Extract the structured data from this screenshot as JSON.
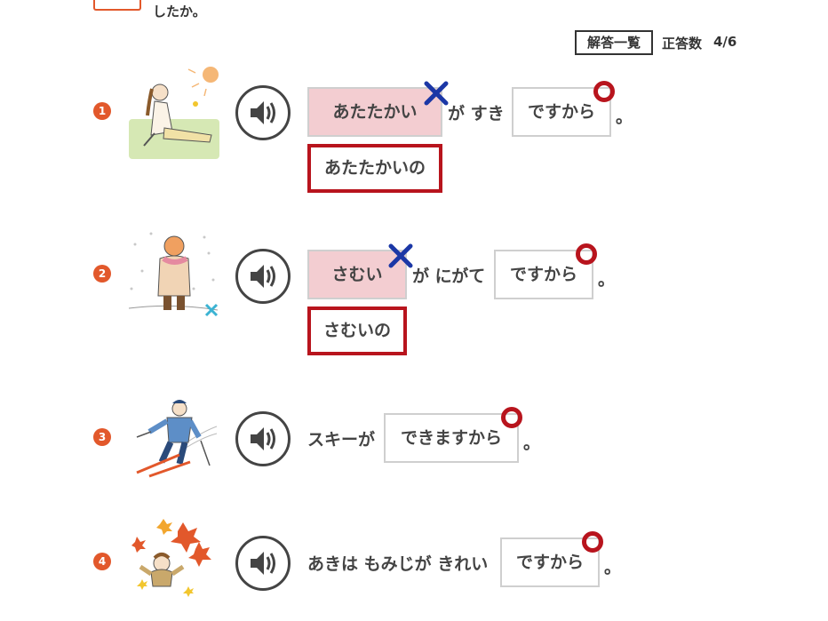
{
  "header": {
    "top_text": "したか。",
    "answers_button": "解答一覧",
    "score_label": "正答数",
    "score_value": "4/6"
  },
  "colors": {
    "accent": "#e2582b",
    "wrong_fill": "#f3cdd1",
    "mark_red": "#b8141d",
    "mark_blue": "#1b37a6"
  },
  "questions": [
    {
      "number": "1",
      "illustration": "woman-relaxing-in-sun",
      "speaker_icon": "speaker-icon",
      "answer1": "あたたかい",
      "answer1_result": "wrong",
      "text1": "が すき",
      "answer2": "ですから",
      "answer2_result": "correct",
      "end": "。",
      "correction": "あたたかいの"
    },
    {
      "number": "2",
      "illustration": "person-cold-in-snow",
      "speaker_icon": "speaker-icon",
      "answer1": "さむい",
      "answer1_result": "wrong",
      "text1": "が にがて",
      "answer2": "ですから",
      "answer2_result": "correct",
      "end": "。",
      "correction": "さむいの"
    },
    {
      "number": "3",
      "illustration": "person-skiing",
      "speaker_icon": "speaker-icon",
      "prefix": "スキーが",
      "answer2": "できますから",
      "answer2_result": "correct",
      "end": "。"
    },
    {
      "number": "4",
      "illustration": "autumn-leaves-girl",
      "speaker_icon": "speaker-icon",
      "prefix": "あきは もみじが きれい",
      "answer2": "ですから",
      "answer2_result": "correct",
      "end": "。"
    }
  ]
}
